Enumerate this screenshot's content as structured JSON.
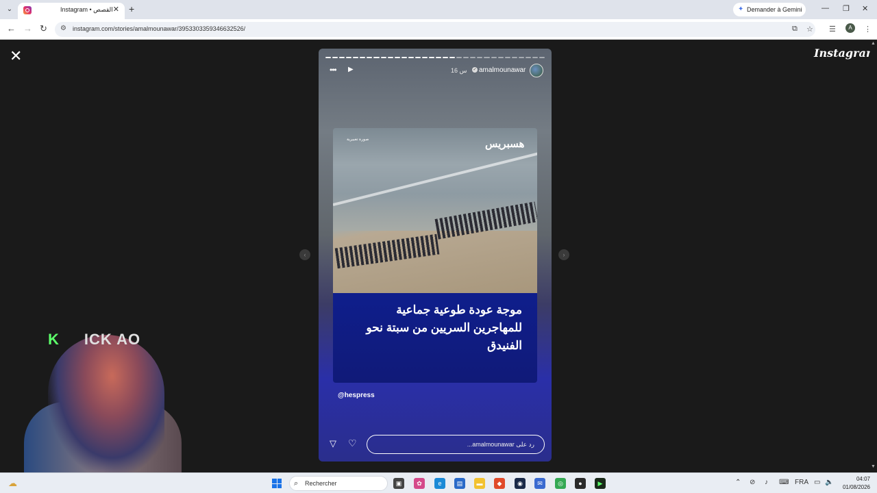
{
  "browser": {
    "tab_title": "Instagram • القصص",
    "tab_close": "✕",
    "new_tab": "+",
    "gemini_label": "Demander à Gemini",
    "url": "instagram.com/stories/amalmounawar/3953303359346632526/",
    "profile_initial": "A"
  },
  "page": {
    "logo": "Instagram",
    "close_label": "✕"
  },
  "story": {
    "progress_total": 32,
    "progress_done": 19,
    "time": "16 س",
    "username": "amalmounawar",
    "photo_tag": "صورة تعبيرية",
    "brand": "هسبريس",
    "headline": "موجة عودة طوعية جماعية للمهاجرين السريين من سبتة نحو الفنيدق",
    "mention": "@hespress",
    "reply_placeholder": "رد على amalmounawar..."
  },
  "overlay": {
    "label_first": "K",
    "label_rest": "ICK   AO"
  },
  "taskbar": {
    "search_placeholder": "Rechercher",
    "language": "FRA",
    "time": "04:07",
    "date": "01/08/2026"
  },
  "icons": {
    "close": "close-icon",
    "more": "more-icon",
    "play": "play-icon",
    "send": "send-icon",
    "heart": "heart-icon"
  },
  "colors": {
    "accent": "#1a73e8",
    "story_blue": "#0f1e8c",
    "overlay_green": "#5cff6a"
  }
}
